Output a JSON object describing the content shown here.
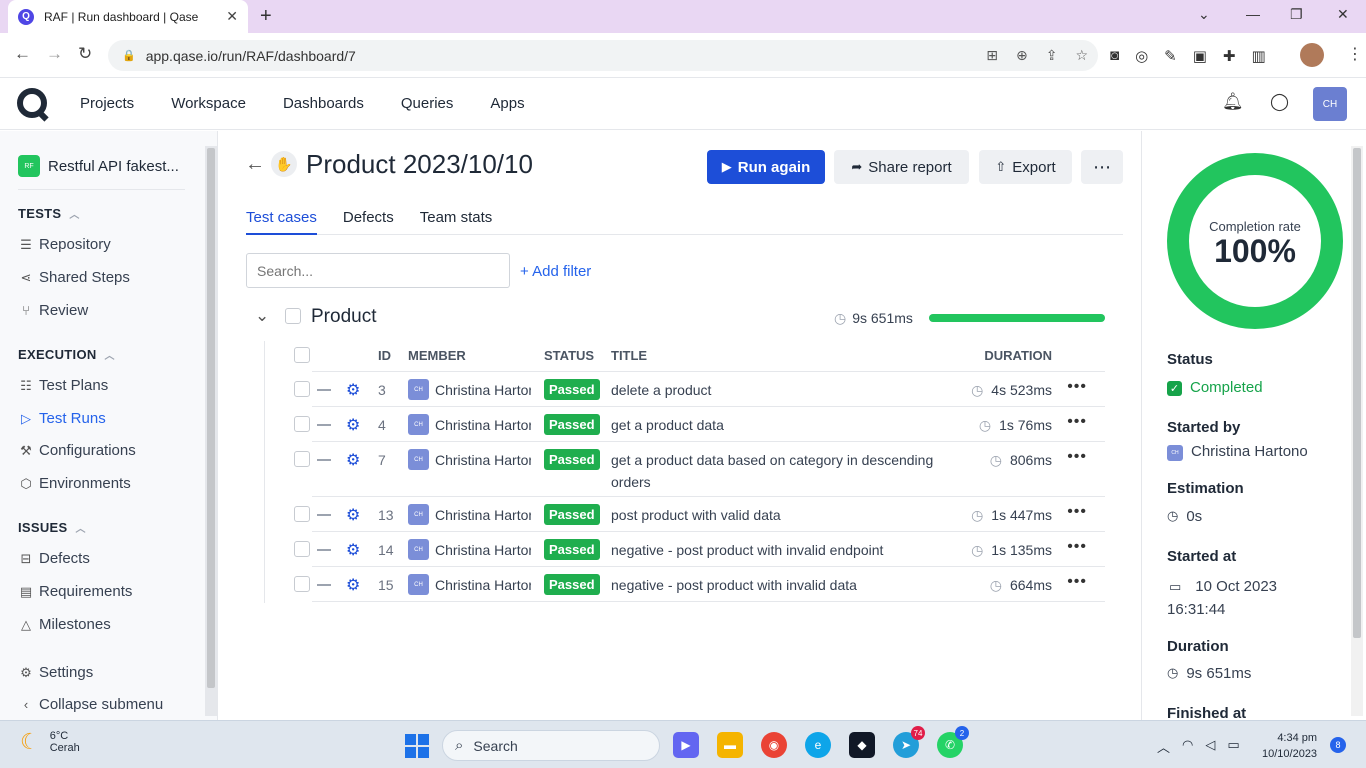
{
  "browser": {
    "tab_title": "RAF | Run dashboard | Qase",
    "tab_favicon": "Q",
    "url": "app.qase.io/run/RAF/dashboard/7"
  },
  "header": {
    "nav": [
      "Projects",
      "Workspace",
      "Dashboards",
      "Queries",
      "Apps"
    ],
    "avatar": "CH"
  },
  "sidebar": {
    "project_badge": "RF",
    "project_name": "Restful API fakest...",
    "tests_section": "TESTS",
    "tests_items": [
      "Repository",
      "Shared Steps",
      "Review"
    ],
    "execution_section": "EXECUTION",
    "execution_items": [
      "Test Plans",
      "Test Runs",
      "Configurations",
      "Environments"
    ],
    "issues_section": "ISSUES",
    "issues_items": [
      "Defects",
      "Requirements",
      "Milestones"
    ],
    "settings": "Settings",
    "collapse": "Collapse submenu"
  },
  "main": {
    "title": "Product 2023/10/10",
    "run_again": "Run again",
    "share_report": "Share report",
    "export": "Export",
    "tabs": [
      "Test cases",
      "Defects",
      "Team stats"
    ],
    "search_placeholder": "Search...",
    "add_filter": "+ Add filter",
    "suite": {
      "name": "Product",
      "duration": "9s 651ms",
      "progress": 1.0
    },
    "columns": {
      "id": "ID",
      "member": "MEMBER",
      "status": "STATUS",
      "title": "TITLE",
      "duration": "DURATION"
    },
    "rows": [
      {
        "id": "3",
        "member_initials": "CH",
        "member": "Christina Hartono",
        "status": "Passed",
        "title": "delete a product",
        "duration": "4s 523ms"
      },
      {
        "id": "4",
        "member_initials": "CH",
        "member": "Christina Hartono",
        "status": "Passed",
        "title": "get a product data",
        "duration": "1s 76ms"
      },
      {
        "id": "7",
        "member_initials": "CH",
        "member": "Christina Hartono",
        "status": "Passed",
        "title": "get a product data based on category in descending orders",
        "duration": "806ms"
      },
      {
        "id": "13",
        "member_initials": "CH",
        "member": "Christina Hartono",
        "status": "Passed",
        "title": "post product with valid data",
        "duration": "1s 447ms"
      },
      {
        "id": "14",
        "member_initials": "CH",
        "member": "Christina Hartono",
        "status": "Passed",
        "title": "negative - post product with invalid endpoint",
        "duration": "1s 135ms"
      },
      {
        "id": "15",
        "member_initials": "CH",
        "member": "Christina Hartono",
        "status": "Passed",
        "title": "negative - post product with invalid data",
        "duration": "664ms"
      }
    ]
  },
  "panel": {
    "completion_label": "Completion rate",
    "completion_value": "100%",
    "status_label": "Status",
    "status_value": "Completed",
    "started_by_label": "Started by",
    "started_by_initials": "CH",
    "started_by_value": "Christina Hartono",
    "estimation_label": "Estimation",
    "estimation_value": "0s",
    "started_at_label": "Started at",
    "started_at_date": "10 Oct 2023",
    "started_at_time": "16:31:44",
    "duration_label": "Duration",
    "duration_value": "9s 651ms",
    "finished_at_label": "Finished at"
  },
  "taskbar": {
    "temperature": "6°C",
    "weather": "Cerah",
    "search": "Search",
    "telegram_badge": "74",
    "whatsapp_badge": "2",
    "time": "4:34 pm",
    "date": "10/10/2023",
    "notifications": "8"
  },
  "colors": {
    "primary": "#1d4ed8",
    "passed": "#1fae4e",
    "progress": "#22c55e"
  }
}
